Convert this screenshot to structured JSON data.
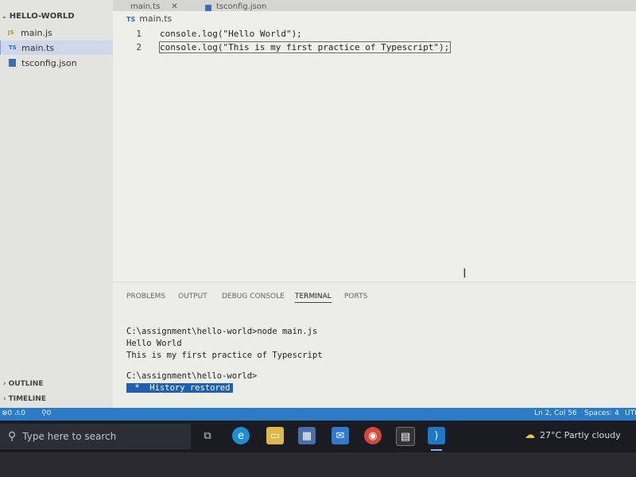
{
  "sidebar": {
    "folder": "HELLO-WORLD",
    "files": [
      {
        "name": "main.js",
        "icon": "JS"
      },
      {
        "name": "main.ts",
        "icon": "TS"
      },
      {
        "name": "tsconfig.json",
        "icon": ""
      }
    ],
    "outline": "OUTLINE",
    "timeline": "TIMELINE"
  },
  "tabs": {
    "tab1": "main.ts",
    "tab2": "tsconfig.json"
  },
  "editor": {
    "breadcrumb_icon": "TS",
    "breadcrumb": "main.ts",
    "lines": [
      {
        "num": "1",
        "code": "console.log(\"Hello World\");"
      },
      {
        "num": "2",
        "code": "console.log(\"This is my first practice of Typescript\");"
      }
    ]
  },
  "panel": {
    "tabs": [
      "PROBLEMS",
      "OUTPUT",
      "DEBUG CONSOLE",
      "TERMINAL",
      "PORTS"
    ],
    "active_tab": "TERMINAL",
    "terminal": [
      "C:\\assignment\\hello-world>node main.js",
      "Hello World",
      "This is my first practice of Typescript",
      "",
      "C:\\assignment\\hello-world>"
    ],
    "history": " *  History restored"
  },
  "statusbar": {
    "errors": "0",
    "warnings": "0",
    "ports": "0",
    "position": "Ln 2, Col 56",
    "spaces": "Spaces: 4",
    "encoding": "UTF"
  },
  "taskbar": {
    "search_placeholder": "Type here to search",
    "weather": "27°C  Partly cloudy"
  },
  "colors": {
    "statusbar": "#2c7bc7",
    "selection": "#cfd8ea",
    "history_badge": "#1f5fb0"
  }
}
